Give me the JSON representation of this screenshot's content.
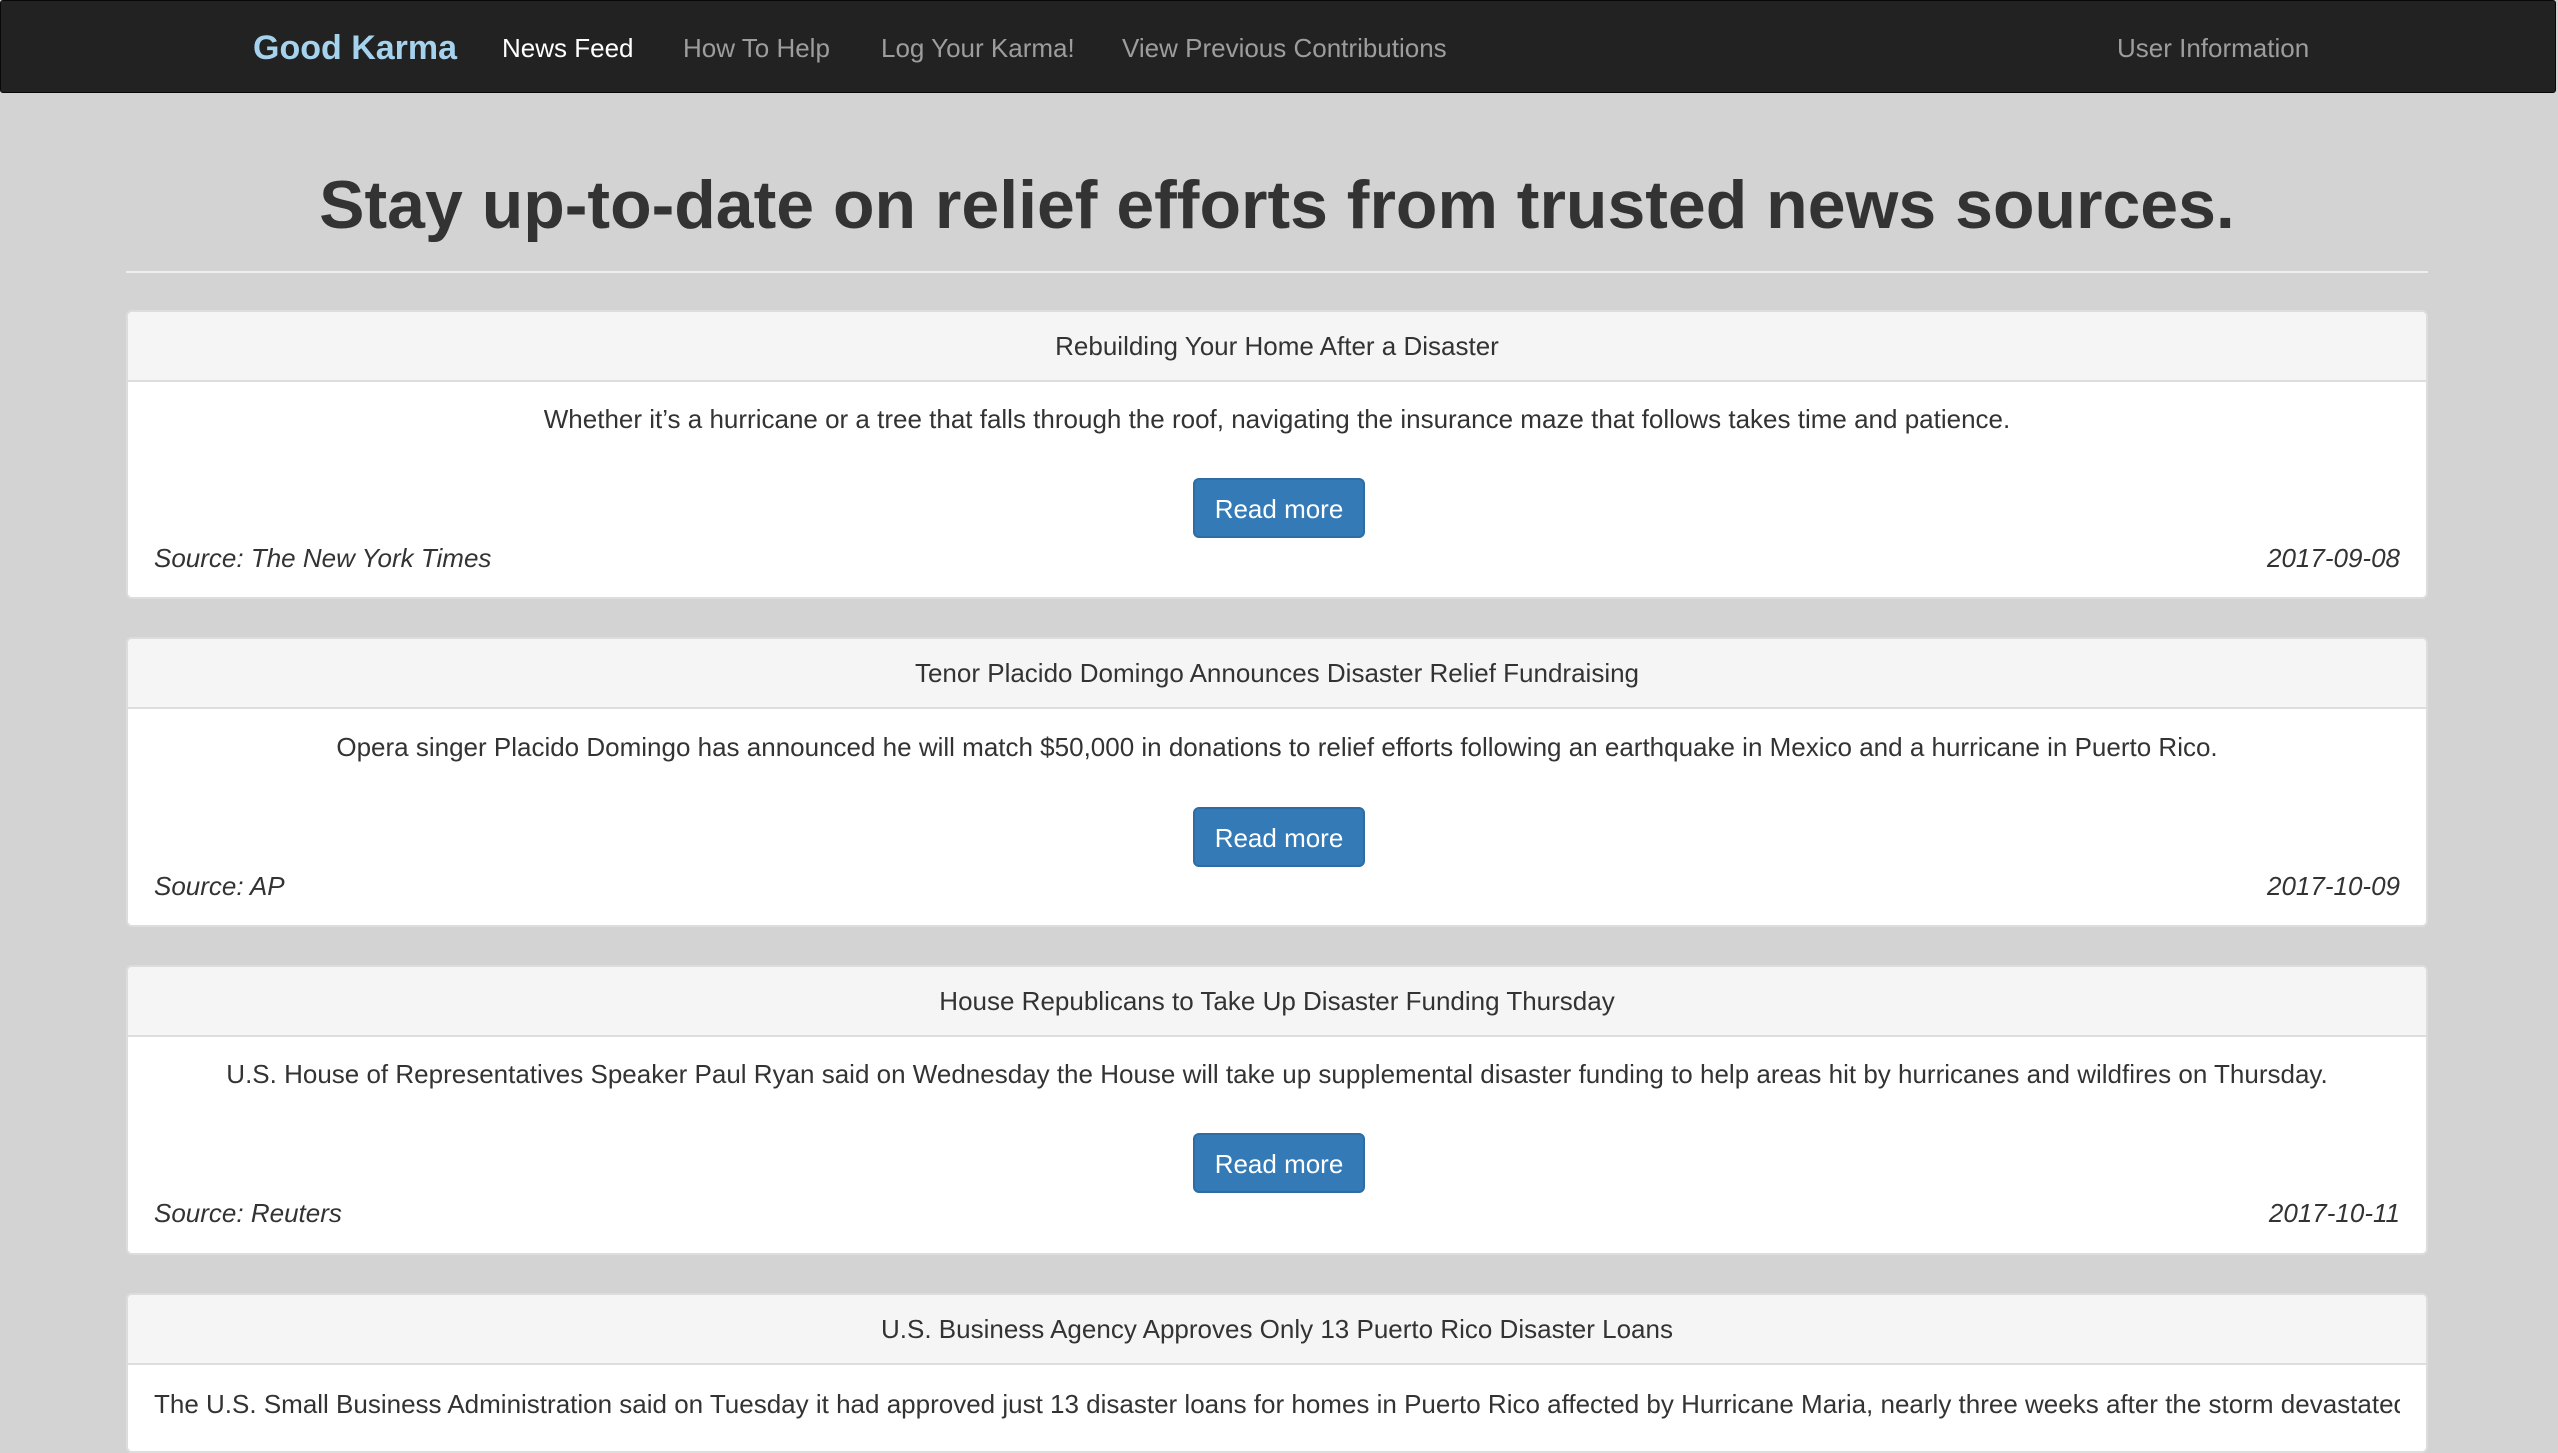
{
  "navbar": {
    "brand": "Good Karma",
    "links": [
      {
        "label": "News Feed",
        "active": true
      },
      {
        "label": "How To Help",
        "active": false
      },
      {
        "label": "Log Your Karma!",
        "active": false
      },
      {
        "label": "View Previous Contributions",
        "active": false
      }
    ],
    "user_info": "User Information"
  },
  "page": {
    "title": "Stay up-to-date on relief efforts from trusted news sources."
  },
  "articles": [
    {
      "title": "Rebuilding Your Home After a Disaster",
      "summary": "Whether it’s a hurricane or a tree that falls through the roof, navigating the insurance maze that follows takes time and patience.",
      "button": "Read more",
      "source": "Source: The New York Times",
      "date": "2017-09-08"
    },
    {
      "title": "Tenor Placido Domingo Announces Disaster Relief Fundraising",
      "summary": "Opera singer Placido Domingo has announced he will match $50,000 in donations to relief efforts following an earthquake in Mexico and a hurricane in Puerto Rico.",
      "button": "Read more",
      "source": "Source: AP",
      "date": "2017-10-09"
    },
    {
      "title": "House Republicans to Take Up Disaster Funding Thursday",
      "summary": "U.S. House of Representatives Speaker Paul Ryan said on Wednesday the House will take up supplemental disaster funding to help areas hit by hurricanes and wildfires on Thursday.",
      "button": "Read more",
      "source": "Source: Reuters",
      "date": "2017-10-11"
    },
    {
      "title": "U.S. Business Agency Approves Only 13 Puerto Rico Disaster Loans",
      "summary": "The U.S. Small Business Administration said on Tuesday it had approved just 13 disaster loans for homes in Puerto Rico affected by Hurricane Maria, nearly three weeks after the storm devastated the"
    }
  ],
  "colors": {
    "page_bg": "#d3d3d3",
    "navbar_bg": "#222222",
    "brand": "#a5d3ee",
    "nav_active": "#ffffff",
    "nav_inactive": "#9d9d9d",
    "button_primary": "#337ab7",
    "card_heading_bg": "#f5f5f5"
  }
}
